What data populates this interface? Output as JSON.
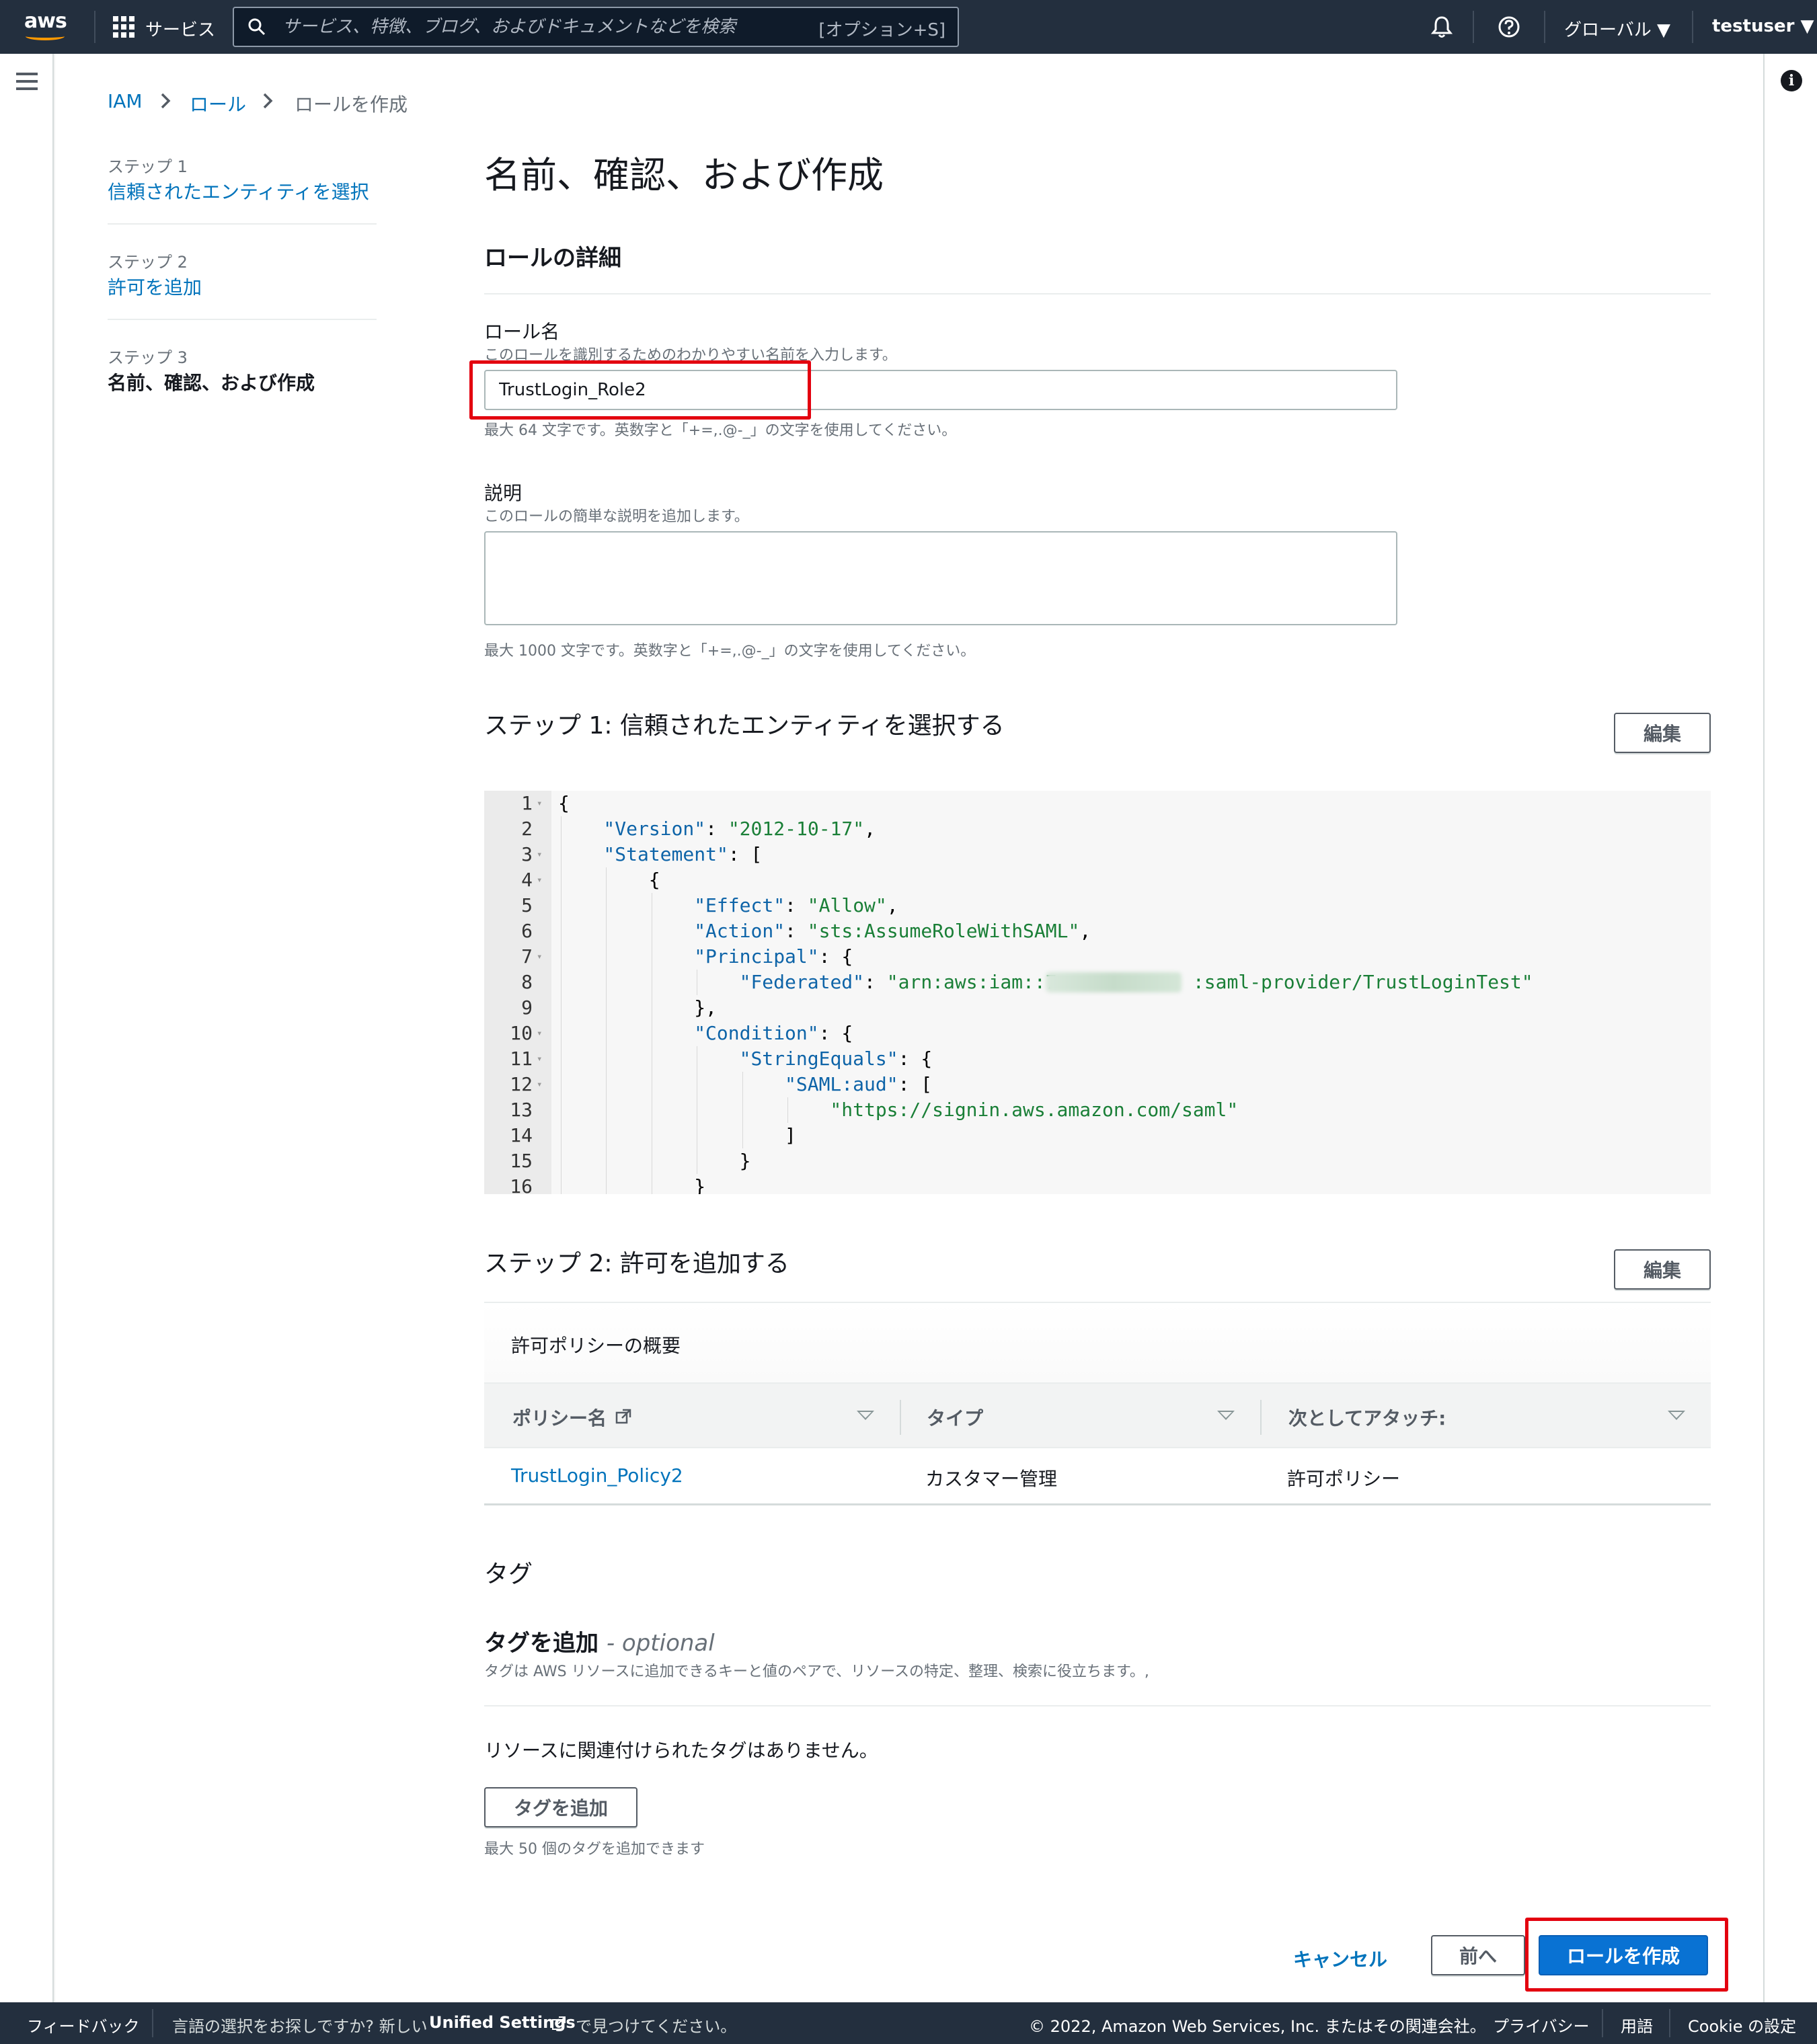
{
  "nav": {
    "logo": "aws",
    "services": "サービス",
    "search_placeholder": "サービス、特徴、ブログ、およびドキュメントなどを検索",
    "search_shortcut": "[オプション+S]",
    "region": "グローバル ▼",
    "user": "testuser ▼"
  },
  "breadcrumb": {
    "iam": "IAM",
    "roles": "ロール",
    "current": "ロールを作成"
  },
  "steps": [
    {
      "label": "ステップ 1",
      "title": "信頼されたエンティティを選択"
    },
    {
      "label": "ステップ 2",
      "title": "許可を追加"
    },
    {
      "label": "ステップ 3",
      "title": "名前、確認、および作成"
    }
  ],
  "page_title": "名前、確認、および作成",
  "role_details": {
    "heading": "ロールの詳細",
    "name_label": "ロール名",
    "name_desc": "このロールを識別するためのわかりやすい名前を入力します。",
    "name_value": "TrustLogin_Role2",
    "name_hint": "最大 64 文字です。英数字と「+=,.@-_」の文字を使用してください。",
    "desc_label": "説明",
    "desc_desc": "このロールの簡単な説明を追加します。",
    "desc_value": "",
    "desc_hint": "最大 1000 文字です。英数字と「+=,.@-_」の文字を使用してください。"
  },
  "step1": {
    "heading": "ステップ 1: 信頼されたエンティティを選択する",
    "edit": "編集",
    "code": [
      {
        "n": "1",
        "fold": true,
        "indent": 0,
        "parts": [
          [
            "p",
            "{"
          ]
        ]
      },
      {
        "n": "2",
        "fold": false,
        "indent": 1,
        "parts": [
          [
            "k",
            "\"Version\""
          ],
          [
            "p",
            ": "
          ],
          [
            "s",
            "\"2012-10-17\""
          ],
          [
            "p",
            ","
          ]
        ]
      },
      {
        "n": "3",
        "fold": true,
        "indent": 1,
        "parts": [
          [
            "k",
            "\"Statement\""
          ],
          [
            "p",
            ": ["
          ]
        ]
      },
      {
        "n": "4",
        "fold": true,
        "indent": 2,
        "parts": [
          [
            "p",
            "{"
          ]
        ]
      },
      {
        "n": "5",
        "fold": false,
        "indent": 3,
        "parts": [
          [
            "k",
            "\"Effect\""
          ],
          [
            "p",
            ": "
          ],
          [
            "s",
            "\"Allow\""
          ],
          [
            "p",
            ","
          ]
        ]
      },
      {
        "n": "6",
        "fold": false,
        "indent": 3,
        "parts": [
          [
            "k",
            "\"Action\""
          ],
          [
            "p",
            ": "
          ],
          [
            "s",
            "\"sts:AssumeRoleWithSAML\""
          ],
          [
            "p",
            ","
          ]
        ]
      },
      {
        "n": "7",
        "fold": true,
        "indent": 3,
        "parts": [
          [
            "k",
            "\"Principal\""
          ],
          [
            "p",
            ": {"
          ]
        ]
      },
      {
        "n": "8",
        "fold": false,
        "indent": 4,
        "parts": [
          [
            "k",
            "\"Federated\""
          ],
          [
            "p",
            ": "
          ],
          [
            "s",
            "\"arn:aws:iam::7            :saml-provider/TrustLoginTest\""
          ]
        ]
      },
      {
        "n": "9",
        "fold": false,
        "indent": 3,
        "parts": [
          [
            "p",
            "},"
          ]
        ]
      },
      {
        "n": "10",
        "fold": true,
        "indent": 3,
        "parts": [
          [
            "k",
            "\"Condition\""
          ],
          [
            "p",
            ": {"
          ]
        ]
      },
      {
        "n": "11",
        "fold": true,
        "indent": 4,
        "parts": [
          [
            "k",
            "\"StringEquals\""
          ],
          [
            "p",
            ": {"
          ]
        ]
      },
      {
        "n": "12",
        "fold": true,
        "indent": 5,
        "parts": [
          [
            "k",
            "\"SAML:aud\""
          ],
          [
            "p",
            ": ["
          ]
        ]
      },
      {
        "n": "13",
        "fold": false,
        "indent": 6,
        "parts": [
          [
            "s",
            "\"https://signin.aws.amazon.com/saml\""
          ]
        ]
      },
      {
        "n": "14",
        "fold": false,
        "indent": 5,
        "parts": [
          [
            "p",
            "]"
          ]
        ]
      },
      {
        "n": "15",
        "fold": false,
        "indent": 4,
        "parts": [
          [
            "p",
            "}"
          ]
        ]
      },
      {
        "n": "16",
        "fold": false,
        "indent": 3,
        "parts": [
          [
            "p",
            "}"
          ]
        ]
      }
    ]
  },
  "step2": {
    "heading": "ステップ 2: 許可を追加する",
    "edit": "編集",
    "table_title": "許可ポリシーの概要",
    "columns": [
      "ポリシー名",
      "タイプ",
      "次としてアタッチ:"
    ],
    "rows": [
      [
        "TrustLogin_Policy2",
        "カスタマー管理",
        "許可ポリシー"
      ]
    ]
  },
  "tags": {
    "heading": "タグ",
    "add_heading": "タグを追加",
    "optional": "- optional",
    "desc": "タグは AWS リソースに追加できるキーと値のペアで、リソースの特定、整理、検索に役立ちます。,",
    "empty": "リソースに関連付けられたタグはありません。",
    "add_button": "タグを追加",
    "limit": "最大 50 個のタグを追加できます"
  },
  "actions": {
    "cancel": "キャンセル",
    "prev": "前へ",
    "create": "ロールを作成"
  },
  "footer": {
    "feedback": "フィードバック",
    "lang_prefix": "言語の選択をお探しですか? 新しい",
    "unified": "Unified Settings",
    "lang_suffix": "で見つけてください。",
    "copyright": "© 2022, Amazon Web Services, Inc. またはその関連会社。",
    "privacy": "プライバシー",
    "terms": "用語",
    "cookie": "Cookie の設定"
  },
  "colors": {
    "nav": "#232f3e",
    "link": "#0073bb",
    "primary": "#0972d3",
    "highlight": "#e3000f"
  }
}
